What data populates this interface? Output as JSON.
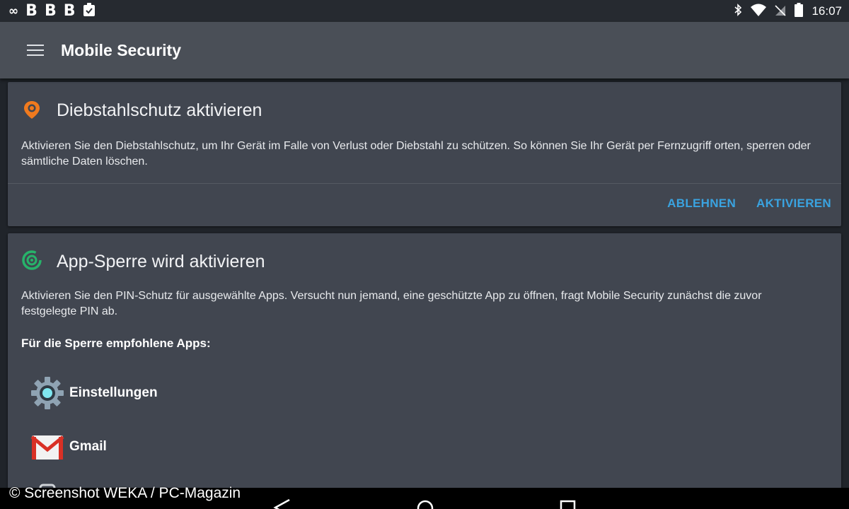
{
  "status_bar": {
    "left_icons": [
      "infinity-icon",
      "b-icon",
      "b-icon",
      "b-icon",
      "clipboard-check-icon"
    ],
    "right_icons": [
      "bluetooth-icon",
      "wifi-icon",
      "no-signal-icon",
      "battery-icon"
    ],
    "time": "16:07"
  },
  "toolbar": {
    "title": "Mobile Security",
    "menu_icon": "hamburger-menu-icon"
  },
  "cards": [
    {
      "icon": "location-pin-icon",
      "icon_color": "#f07a1e",
      "title": "Diebstahlschutz aktivieren",
      "body": "Aktivieren Sie den Diebstahlschutz, um Ihr Gerät im Falle von Verlust oder Diebstahl zu schützen. So können Sie Ihr Gerät per Fernzugriff orten, sperren oder sämtliche Daten löschen.",
      "actions": {
        "decline": "ABLEHNEN",
        "activate": "AKTIVIEREN"
      }
    },
    {
      "icon": "app-lock-icon",
      "icon_color": "#27b36a",
      "title": "App-Sperre wird aktivieren",
      "body": "Aktivieren Sie den PIN-Schutz für ausgewählte Apps. Versucht nun jemand, eine geschützte App zu öffnen, fragt Mobile Security zunächst die zuvor festgelegte PIN ab.",
      "subheading": "Für die Sperre empfohlene Apps:",
      "apps": [
        {
          "label": "Einstellungen",
          "icon": "settings-gear-icon"
        },
        {
          "label": "Gmail",
          "icon": "gmail-icon"
        }
      ]
    }
  ],
  "watermark": "© Screenshot WEKA / PC-Magazin",
  "nav_bar": {
    "icons": [
      "back-icon",
      "home-icon",
      "recents-icon"
    ]
  },
  "colors": {
    "accent": "#3aa3e0",
    "card_bg": "#414650",
    "toolbar_bg": "#4a4f57"
  }
}
